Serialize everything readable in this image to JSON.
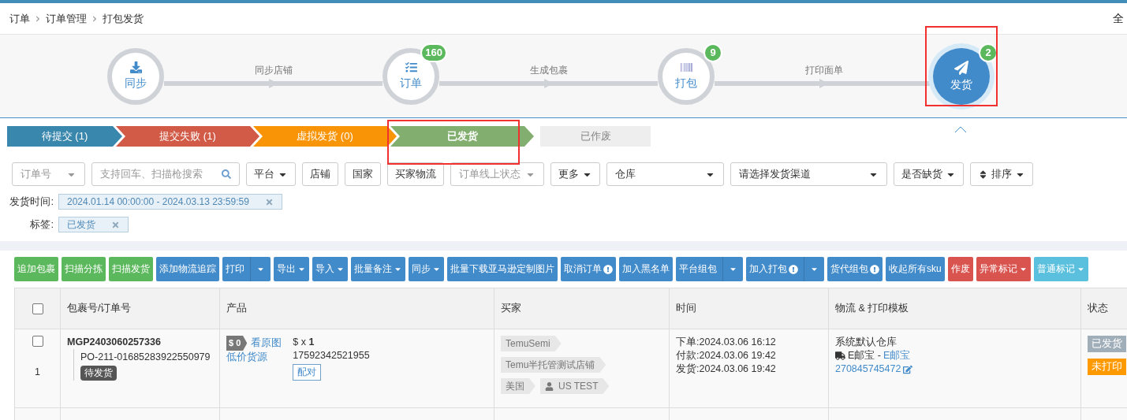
{
  "breadcrumb": [
    "订单",
    "订单管理",
    "打包发货"
  ],
  "header_right": "全",
  "steps": [
    {
      "label": "同步",
      "selected": false,
      "highlighted": false
    },
    {
      "label": "订单",
      "badge": "160",
      "selected": false,
      "highlighted": false
    },
    {
      "label": "打包",
      "badge": "9",
      "selected": false,
      "highlighted": false
    },
    {
      "label": "发货",
      "badge": "2",
      "selected": true,
      "highlighted": true
    }
  ],
  "connectors": [
    "同步店铺",
    "生成包裹",
    "打印面单"
  ],
  "status_tabs": [
    {
      "label": "待提交 (1)",
      "color": "#3a87ad",
      "kind": "arrow",
      "selected": false,
      "highlighted": false
    },
    {
      "label": "提交失败 (1)",
      "color": "#d15b47",
      "kind": "arrow",
      "selected": false,
      "highlighted": false
    },
    {
      "label": "虚拟发货 (0)",
      "color": "#f89406",
      "kind": "arrow",
      "selected": false,
      "highlighted": false
    },
    {
      "label": "已发货",
      "color": "#82af6f",
      "kind": "arrow",
      "selected": true,
      "highlighted": true
    },
    {
      "label": "已作废",
      "color": "#eeeeee",
      "kind": "plain",
      "selected": false,
      "highlighted": false
    }
  ],
  "filters": [
    {
      "kind": "select",
      "placeholder": "订单号"
    },
    {
      "kind": "search",
      "placeholder": "支持回车、扫描枪搜索"
    },
    {
      "kind": "dropdown",
      "label": "平台"
    },
    {
      "kind": "button",
      "label": "店铺"
    },
    {
      "kind": "button",
      "label": "国家"
    },
    {
      "kind": "button",
      "label": "买家物流"
    },
    {
      "kind": "select",
      "placeholder": "订单线上状态"
    },
    {
      "kind": "dropdown",
      "label": "更多"
    },
    {
      "kind": "select",
      "value": "仓库"
    },
    {
      "kind": "select",
      "value": "请选择发货渠道"
    },
    {
      "kind": "dropdown",
      "label": "是否缺货"
    },
    {
      "kind": "sort",
      "label": "排序"
    }
  ],
  "active_filters": [
    {
      "label": "发货时间:",
      "value": "2024.01.14 00:00:00 - 2024.03.13 23:59:59"
    },
    {
      "label": "标签:",
      "value": "已发货"
    }
  ],
  "actions": [
    {
      "label": "追加包裹",
      "color": "#5cb85c",
      "kind": "plain"
    },
    {
      "label": "扫描分拣",
      "color": "#5cb85c",
      "kind": "plain"
    },
    {
      "label": "扫描发货",
      "color": "#5cb85c",
      "kind": "plain"
    },
    {
      "label": "添加物流追踪",
      "color": "#428bca",
      "kind": "plain"
    },
    {
      "label": "打印",
      "color": "#428bca",
      "kind": "split"
    },
    {
      "label": "导出",
      "color": "#428bca",
      "kind": "caret"
    },
    {
      "label": "导入",
      "color": "#428bca",
      "kind": "caret"
    },
    {
      "label": "批量备注",
      "color": "#428bca",
      "kind": "caret"
    },
    {
      "label": "同步",
      "color": "#428bca",
      "kind": "caret"
    },
    {
      "label": "批量下载亚马逊定制图片",
      "color": "#428bca",
      "kind": "plain"
    },
    {
      "label": "取消订单",
      "color": "#428bca",
      "kind": "alert"
    },
    {
      "label": "加入黑名单",
      "color": "#428bca",
      "kind": "plain"
    },
    {
      "label": "平台组包",
      "color": "#428bca",
      "kind": "split"
    },
    {
      "label": "加入打包",
      "color": "#428bca",
      "kind": "alertsplit"
    },
    {
      "label": "货代组包",
      "color": "#428bca",
      "kind": "alert"
    },
    {
      "label": "收起所有sku",
      "color": "#428bca",
      "kind": "plain"
    },
    {
      "label": "作废",
      "color": "#d9534f",
      "kind": "plain"
    },
    {
      "label": "异常标记",
      "color": "#d9534f",
      "kind": "caret"
    },
    {
      "label": "普通标记",
      "color": "#5bc0de",
      "kind": "caret"
    }
  ],
  "table": {
    "select_all": {
      "checked": false
    },
    "columns": [
      "包裹号/订单号",
      "产品",
      "买家",
      "时间",
      "物流 & 打印模板",
      "状态"
    ],
    "rows": [
      {
        "checked": false,
        "index": "1",
        "package_no": "MGP2403060257336",
        "order_no": "PO-211-01685283922550979",
        "order_badge": "待发货",
        "price_tag": "$ 0",
        "product_links": [
          "看原图",
          "低价货源"
        ],
        "quantity": "$ x **1**",
        "sku": "17592342521955",
        "pair_button": "配对",
        "buyer_tags": [
          {
            "kind": "tag",
            "text": "TemuSemi"
          },
          {
            "kind": "tag",
            "text": "Temu半托管测试店铺"
          },
          {
            "kind": "tag",
            "text": "美国"
          },
          {
            "kind": "user",
            "text": "US TEST"
          }
        ],
        "times": [
          "下单:2024.03.06 16:12",
          "付款:2024.03.06 19:42",
          "发货:2024.03.06 19:42"
        ],
        "warehouse": "系统默认仓库",
        "carrier": "E邮宝 - ",
        "carrier_link": "E邮宝",
        "tracking_no": "270845745472",
        "statuses": [
          {
            "text": "已发货",
            "color": "#a0aeba"
          },
          {
            "text": "未打印",
            "color": "#ff9900"
          }
        ]
      }
    ]
  }
}
